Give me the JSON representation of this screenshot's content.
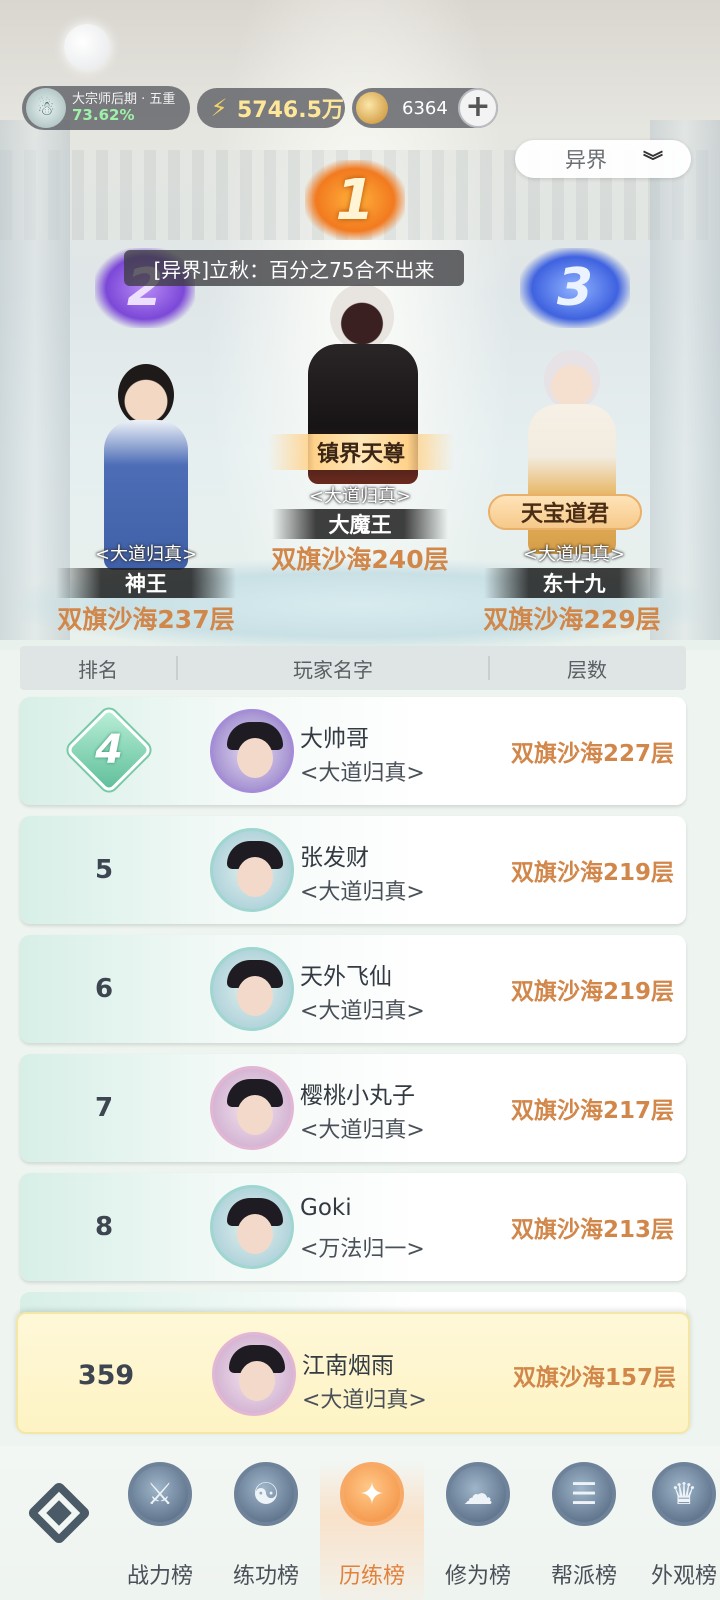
{
  "status": {
    "realm_title": "大宗师后期 · 五重",
    "realm_progress": "73.62%",
    "power": "5746.5万",
    "currency": "6364",
    "add_symbol": "+"
  },
  "filter": {
    "selected": "异界",
    "chevron": "⌄"
  },
  "chat_message": "[异界]立秋：百分之75合不出来",
  "podium": [
    {
      "rank": "1",
      "name": "大魔王",
      "sect": "<大道归真>",
      "level": "双旗沙海240层",
      "title": "镇界天尊"
    },
    {
      "rank": "2",
      "name": "神王",
      "sect": "<大道归真>",
      "level": "双旗沙海237层"
    },
    {
      "rank": "3",
      "name": "东十九",
      "sect": "<大道归真>",
      "level": "双旗沙海229层",
      "title": "天宝道君"
    }
  ],
  "table_header": {
    "rank": "排名",
    "player": "玩家名字",
    "floors": "层数"
  },
  "rows": [
    {
      "rank": "4",
      "name": "大帅哥",
      "sect": "<大道归真>",
      "level": "双旗沙海227层"
    },
    {
      "rank": "5",
      "name": "张发财",
      "sect": "<大道归真>",
      "level": "双旗沙海219层"
    },
    {
      "rank": "6",
      "name": "天外飞仙",
      "sect": "<大道归真>",
      "level": "双旗沙海219层"
    },
    {
      "rank": "7",
      "name": "樱桃小丸子",
      "sect": "<大道归真>",
      "level": "双旗沙海217层"
    },
    {
      "rank": "8",
      "name": "Goki",
      "sect": "<万法归一>",
      "level": "双旗沙海213层"
    }
  ],
  "my_rank": {
    "rank": "359",
    "name": "江南烟雨",
    "sect": "<大道归真>",
    "level": "双旗沙海157层"
  },
  "nav": {
    "tabs": [
      {
        "label": "战力榜",
        "icon": "crossed-swords-icon",
        "glyph": "⚔"
      },
      {
        "label": "练功榜",
        "icon": "yin-yang-icon",
        "glyph": "☯"
      },
      {
        "label": "历练榜",
        "icon": "sparkle-icon",
        "glyph": "✦"
      },
      {
        "label": "修为榜",
        "icon": "cloud-icon",
        "glyph": "☁"
      },
      {
        "label": "帮派榜",
        "icon": "banner-icon",
        "glyph": "☰"
      },
      {
        "label": "外观榜",
        "icon": "costume-icon",
        "glyph": "♛"
      }
    ],
    "active_index": 2
  },
  "colors": {
    "level_text": "#d2874a",
    "active_tab": "#e0823e",
    "realm_progress": "#9ff0a8"
  }
}
